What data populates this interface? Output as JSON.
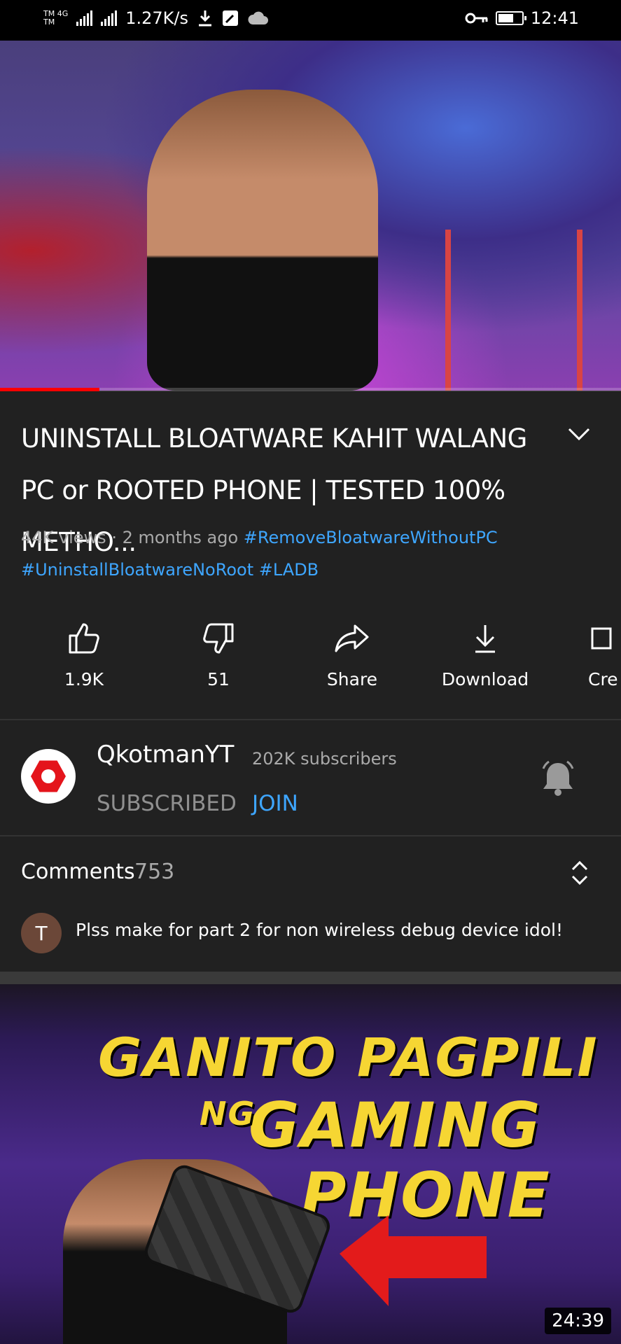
{
  "status_bar": {
    "carrier_top": "TM 4G",
    "carrier_bottom": "TM",
    "net_speed": "1.27K/s",
    "time": "12:41",
    "icons": [
      "signal-icon",
      "download-icon",
      "edit-icon",
      "cloud-icon",
      "key-icon",
      "battery-icon"
    ]
  },
  "video": {
    "progress": 0.16,
    "title": "UNINSTALL BLOATWARE KAHIT WALANG PC or ROOTED PHONE | TESTED 100% METHO...",
    "views": "44K views",
    "age": "2 months ago",
    "hashtags": [
      "#RemoveBloatwareWithoutPC",
      "#UninstallBloatwareNoRoot",
      "#LADB"
    ]
  },
  "actions": [
    {
      "id": "like",
      "label": "1.9K",
      "icon": "thumbs-up-icon"
    },
    {
      "id": "dislike",
      "label": "51",
      "icon": "thumbs-down-icon"
    },
    {
      "id": "share",
      "label": "Share",
      "icon": "share-icon"
    },
    {
      "id": "download",
      "label": "Download",
      "icon": "download-icon"
    },
    {
      "id": "create",
      "label": "Cre",
      "icon": "create-icon"
    }
  ],
  "channel": {
    "name": "QkotmanYT",
    "subscribers": "202K subscribers",
    "subscribed_label": "SUBSCRIBED",
    "join_label": "JOIN"
  },
  "comments": {
    "header": "Comments",
    "count": "753",
    "first": {
      "avatar_letter": "T",
      "text": "Plss make for part 2 for non wireless debug device idol!"
    }
  },
  "next_video": {
    "thumb_line1": "GANITO PAGPILI",
    "thumb_ng": "NG",
    "thumb_line2": "GAMING",
    "thumb_line3": "PHONE",
    "duration": "24:39"
  },
  "colors": {
    "background": "#212121",
    "link": "#3ea6ff",
    "progress": "#ff0000",
    "thumb_text": "#f6d633"
  }
}
